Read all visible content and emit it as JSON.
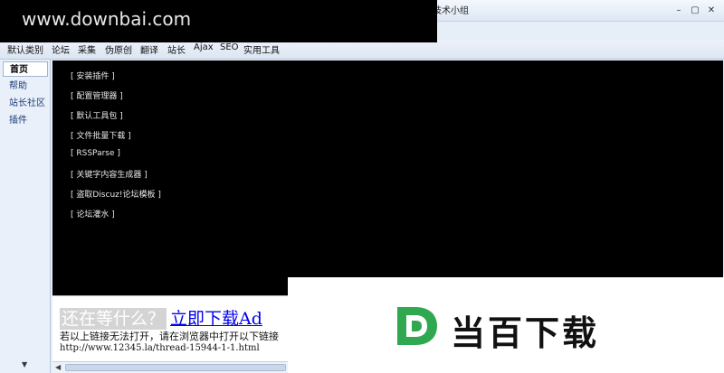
{
  "window": {
    "title": "技术小组",
    "buttons": [
      "–",
      "▢",
      "✕"
    ]
  },
  "watermark_top": {
    "text": "www.downbai.com"
  },
  "menubar": {
    "items": [
      "默认类别",
      "论坛",
      "采集",
      "伪原创",
      "翻译",
      "站长",
      "Ajax",
      "SEO",
      "实用工具"
    ]
  },
  "leftnav": {
    "items": [
      "首页",
      "帮助",
      "站长社区",
      "插件"
    ],
    "scroll_down": "▼"
  },
  "plugins": [
    "[ 安装插件 ]",
    "[ 配置管理器 ]",
    "[ 默认工具包 ]",
    "[ 文件批量下载 ]",
    "[ RSSParse ]",
    "[ 关键字内容生成器 ]",
    "[ 盗取Discuz!论坛模板 ]",
    "[ 论坛灌水 ]"
  ],
  "browser": {
    "wait_text": "还在等什么？",
    "download_link": "立即下载Ad",
    "hint": "若以上链接无法打开，请在浏览器中打开以下链接",
    "url": "http://www.12345.la/thread-15944-1-1.html",
    "scroll_left": "◀"
  },
  "watermark_bottom": {
    "logo_letter": "D",
    "text": "当百下载",
    "logo_color": "#2fa84f"
  }
}
